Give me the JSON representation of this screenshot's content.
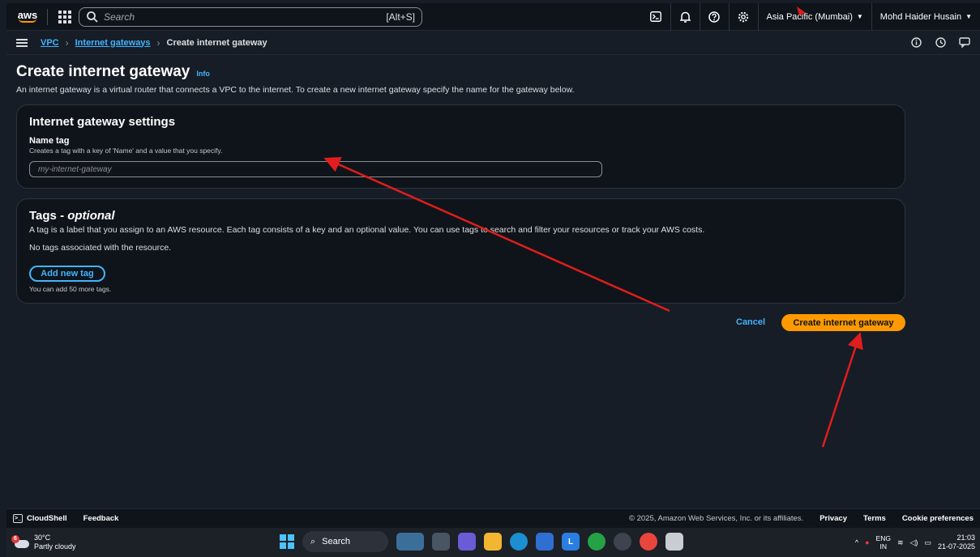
{
  "topnav": {
    "logo_text": "aws",
    "search_placeholder": "Search",
    "search_shortcut": "[Alt+S]",
    "region": "Asia Pacific (Mumbai)",
    "user": "Mohd Haider Husain"
  },
  "breadcrumb": {
    "items": [
      "VPC",
      "Internet gateways",
      "Create internet gateway"
    ]
  },
  "page": {
    "title": "Create internet gateway",
    "info": "Info",
    "description": "An internet gateway is a virtual router that connects a VPC to the internet. To create a new internet gateway specify the name for the gateway below."
  },
  "settings_panel": {
    "title": "Internet gateway settings",
    "name_label": "Name tag",
    "name_hint": "Creates a tag with a key of 'Name' and a value that you specify.",
    "name_placeholder": "my-internet-gateway"
  },
  "tags_panel": {
    "title_main": "Tags - ",
    "title_optional": "optional",
    "description": "A tag is a label that you assign to an AWS resource. Each tag consists of a key and an optional value. You can use tags to search and filter your resources or track your AWS costs.",
    "empty_text": "No tags associated with the resource.",
    "add_button": "Add new tag",
    "limit_text": "You can add 50 more tags."
  },
  "actions": {
    "cancel": "Cancel",
    "create": "Create internet gateway"
  },
  "footer": {
    "cloudshell": "CloudShell",
    "feedback": "Feedback",
    "copyright": "© 2025, Amazon Web Services, Inc. or its affiliates.",
    "privacy": "Privacy",
    "terms": "Terms",
    "cookies": "Cookie preferences"
  },
  "taskbar": {
    "weather_badge": "6",
    "temperature": "30°C",
    "condition": "Partly cloudy",
    "search": "Search",
    "lang_top": "ENG",
    "lang_bottom": "IN",
    "time": "21:03",
    "date": "21-07-2025"
  },
  "colors": {
    "accent_orange": "#ff9900",
    "link_blue": "#42b4ff",
    "annotation_red": "#e11d1d"
  }
}
